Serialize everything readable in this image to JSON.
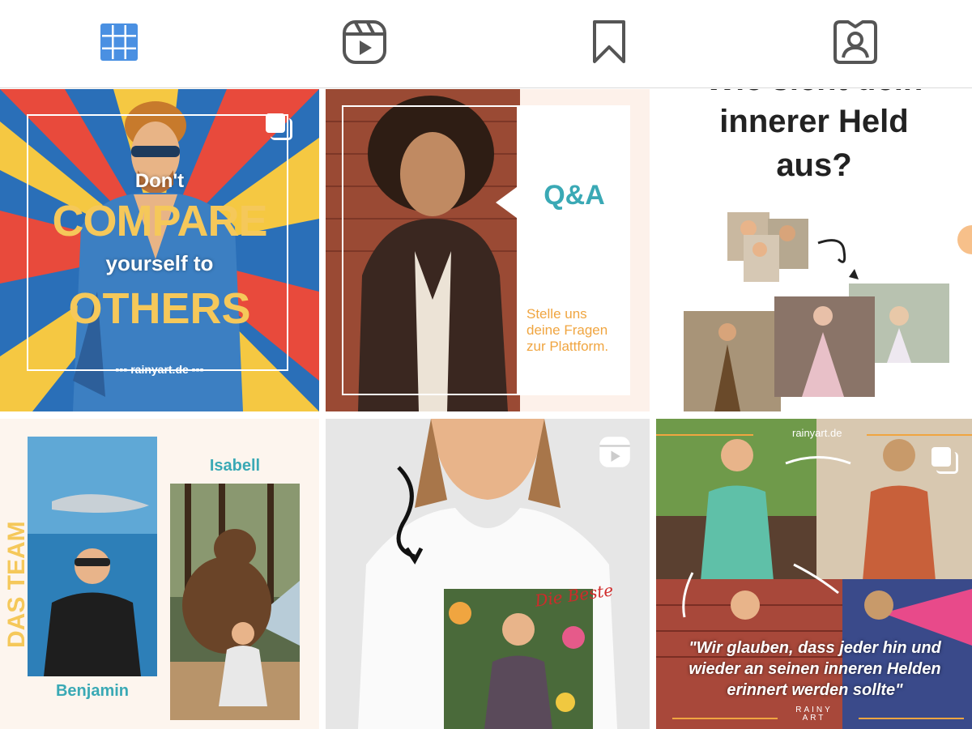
{
  "tabs": [
    {
      "name": "posts",
      "icon": "grid-icon",
      "active": true
    },
    {
      "name": "reels",
      "icon": "reels-icon",
      "active": false
    },
    {
      "name": "saved",
      "icon": "bookmark-icon",
      "active": false
    },
    {
      "name": "tagged",
      "icon": "tagged-person-icon",
      "active": false
    }
  ],
  "colors": {
    "active_tab": "#4a90e2",
    "inactive_tab": "#555555",
    "accent_teal": "#3aa9b5",
    "accent_orange": "#f0a540",
    "accent_yellow": "#f5c85a"
  },
  "posts": {
    "p1": {
      "line1": "Don't",
      "line2": "COMPARE",
      "line3": "yourself to",
      "line4": "OTHERS",
      "footer": "rainyart.de",
      "badge": "multi-image-icon"
    },
    "p2": {
      "qa": "Q&A",
      "body": "Stelle uns\ndeine Fragen\nzur Plattform."
    },
    "p3": {
      "partial": "Wie sieht dein",
      "line1": "innerer Held",
      "line2": "aus?"
    },
    "p4": {
      "side": "DAS TEAM",
      "name1": "Isabell",
      "name2": "Benjamin"
    },
    "p5": {
      "script": "Die Beste",
      "badge": "reel-icon"
    },
    "p6": {
      "watermark": "rainyart.de",
      "quote": "\"Wir glauben, dass jeder hin und wieder an seinen inneren Helden erinnert werden sollte\"",
      "logo": "RAINY ART",
      "badge": "multi-image-icon"
    }
  }
}
